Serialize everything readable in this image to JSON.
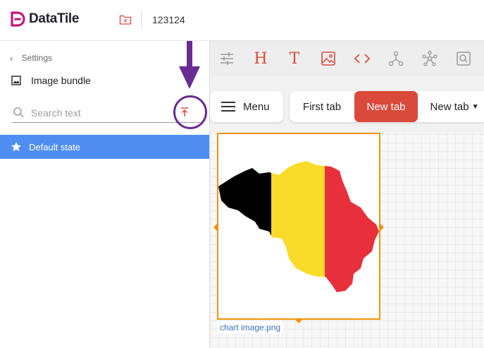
{
  "app": {
    "name": "DataTile",
    "project": "123124"
  },
  "colors": {
    "accent": "#d94a3a",
    "selected_row": "#4f8ef0",
    "selection_border": "#f0930c",
    "annotation": "#6a2c91"
  },
  "sidebar": {
    "back_label": "Settings",
    "section_title": "Image bundle",
    "search": {
      "placeholder": "Search text",
      "value": ""
    },
    "states": [
      {
        "label": "Default state",
        "selected": true
      }
    ]
  },
  "toolbar": {
    "icons": [
      "filters-icon",
      "heading-icon",
      "text-icon",
      "image-icon",
      "code-icon",
      "share-nodes-icon",
      "network-icon",
      "search-frame-icon"
    ],
    "heading_glyph": "H",
    "text_glyph": "T"
  },
  "tabs": {
    "menu_label": "Menu",
    "items": [
      {
        "label": "First tab",
        "active": false
      },
      {
        "label": "New tab",
        "active": true
      },
      {
        "label": "New tab",
        "active": false,
        "dropdown": true
      }
    ]
  },
  "canvas": {
    "image_caption": "chart image.png",
    "flag_colors": [
      "#000000",
      "#fbdb2a",
      "#e8303c"
    ]
  }
}
